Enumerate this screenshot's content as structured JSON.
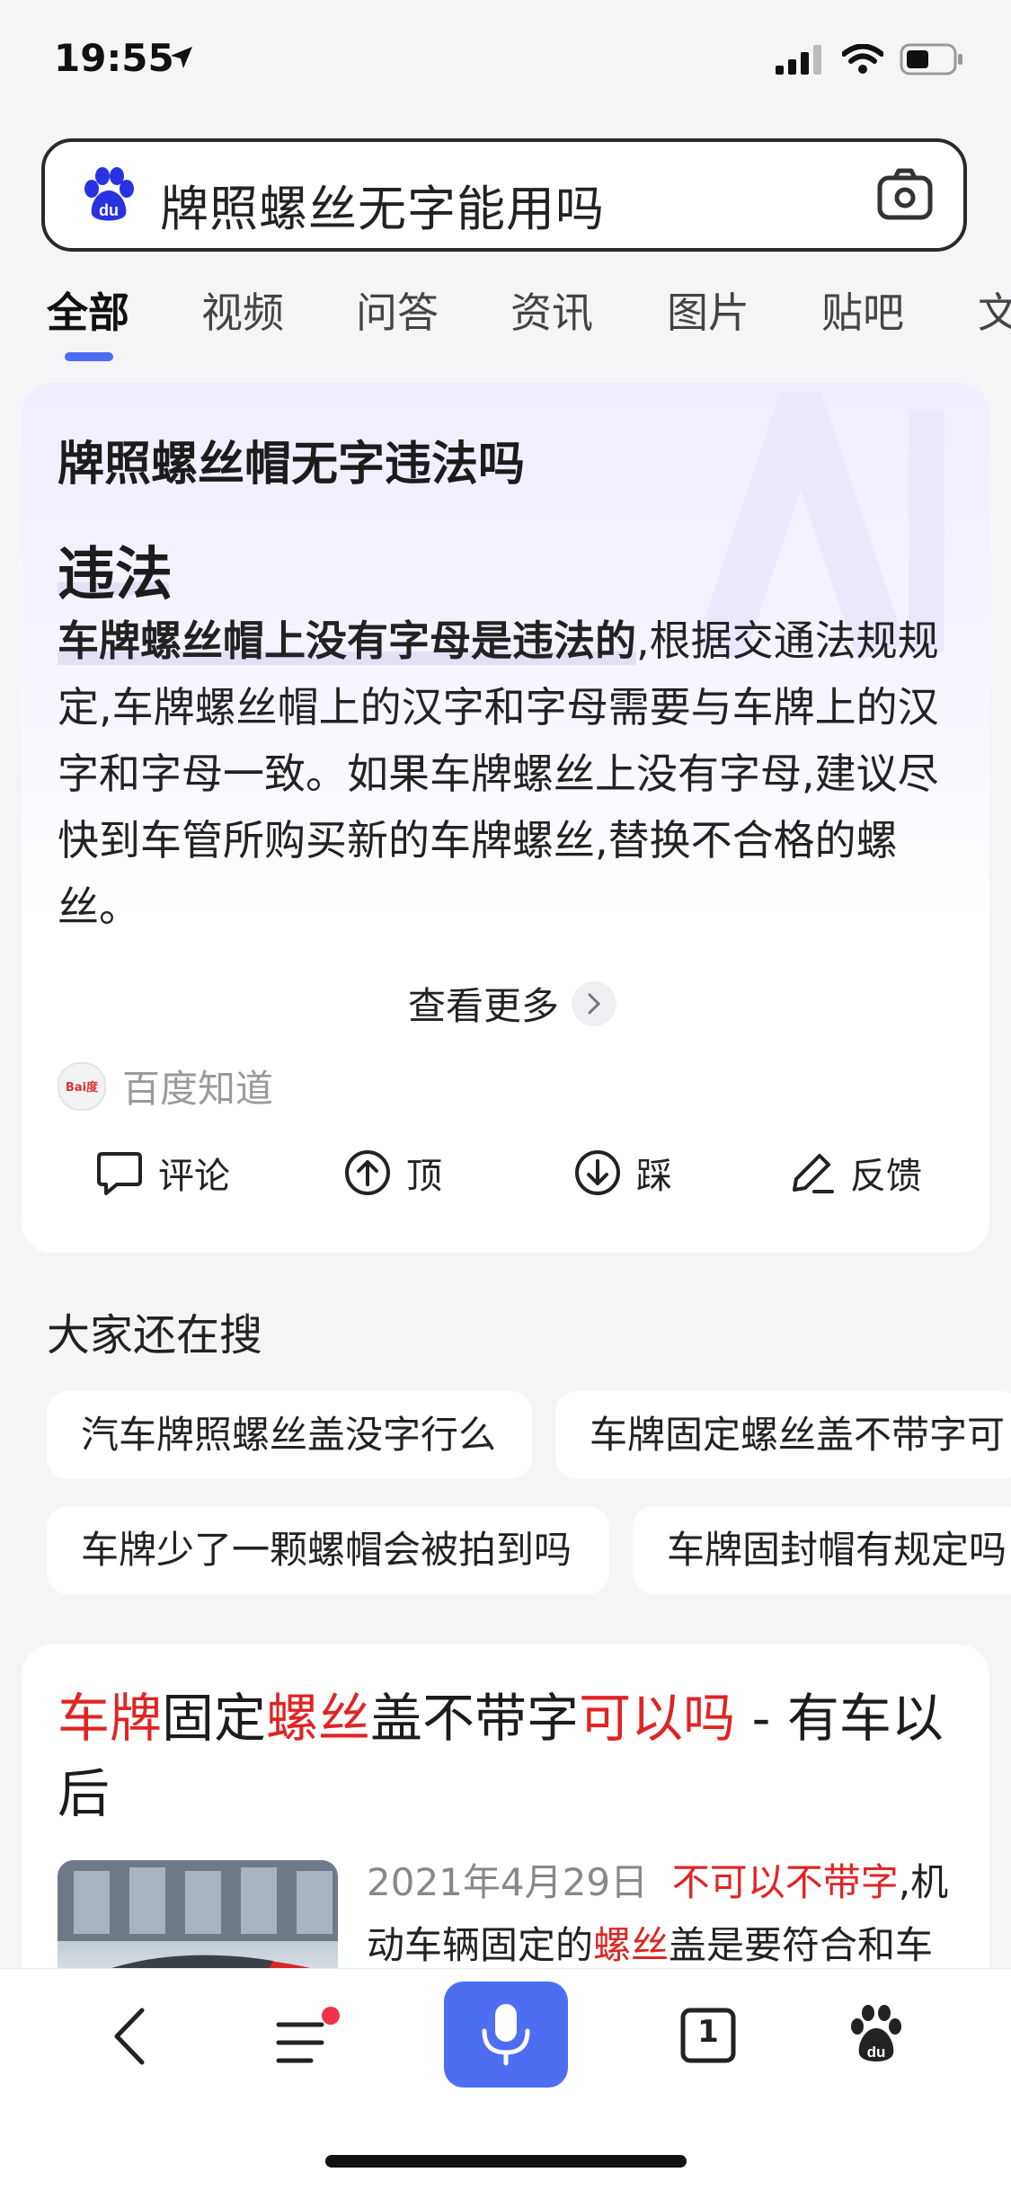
{
  "status": {
    "time": "19:55"
  },
  "search": {
    "query": "牌照螺丝无字能用吗"
  },
  "tabs": [
    "全部",
    "视频",
    "问答",
    "资讯",
    "图片",
    "贴吧",
    "文"
  ],
  "ai_card": {
    "question": "牌照螺丝帽无字违法吗",
    "answer": "违法",
    "body_bold": "车牌螺丝帽上没有字母是违法的",
    "body_rest": ",根据交通法规规定,车牌螺丝帽上的汉字和字母需要与车牌上的汉字和字母一致。如果车牌螺丝上没有字母,建议尽快到车管所购买新的车牌螺丝,替换不合格的螺丝。",
    "more_label": "查看更多",
    "source_name": "百度知道",
    "source_logo_text": "Bai度",
    "actions": {
      "comment": "评论",
      "up": "顶",
      "down": "踩",
      "feedback": "反馈"
    }
  },
  "related": {
    "title": "大家还在搜",
    "chips": [
      "汽车牌照螺丝盖没字行么",
      "车牌固定螺丝盖不带字可",
      "车牌少了一颗螺帽会被拍到吗",
      "车牌固封帽有规定吗"
    ]
  },
  "result": {
    "title_parts": [
      "车牌",
      "固定",
      "螺丝",
      "盖不带字",
      "可以吗",
      " - 有车以后"
    ],
    "date": "2021年4月29日",
    "snippet_hl1": "不可以不带字",
    "snippet_t1": ",机动车辆固定的",
    "snippet_hl2": "螺丝",
    "snippet_t2": "盖是要符合和车"
  },
  "bottom_nav": {
    "tabs_count": "1"
  },
  "colors": {
    "accent": "#4e6ef2",
    "highlight": "#e02424",
    "notify_dot": "#f0334a"
  }
}
